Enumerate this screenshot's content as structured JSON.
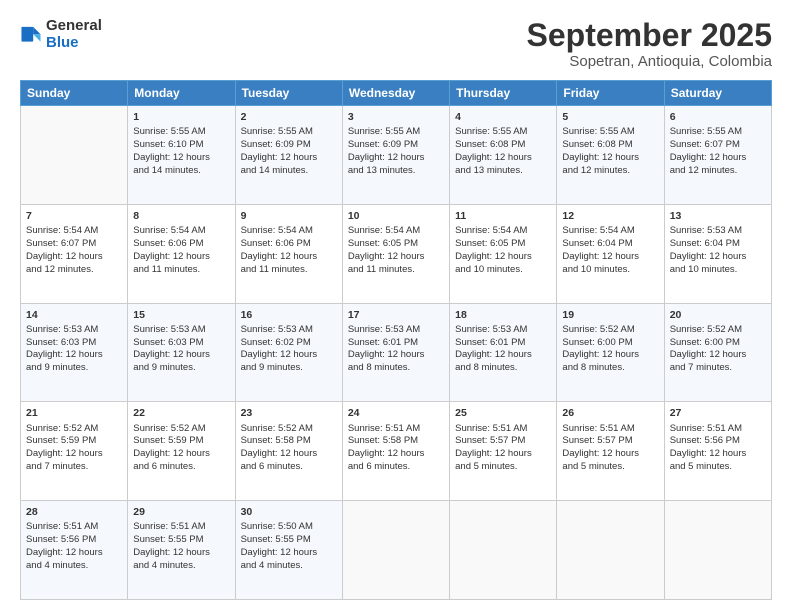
{
  "header": {
    "logo_line1": "General",
    "logo_line2": "Blue",
    "title": "September 2025",
    "subtitle": "Sopetran, Antioquia, Colombia"
  },
  "columns": [
    "Sunday",
    "Monday",
    "Tuesday",
    "Wednesday",
    "Thursday",
    "Friday",
    "Saturday"
  ],
  "weeks": [
    [
      {
        "day": "",
        "info": ""
      },
      {
        "day": "1",
        "info": "Sunrise: 5:55 AM\nSunset: 6:10 PM\nDaylight: 12 hours\nand 14 minutes."
      },
      {
        "day": "2",
        "info": "Sunrise: 5:55 AM\nSunset: 6:09 PM\nDaylight: 12 hours\nand 14 minutes."
      },
      {
        "day": "3",
        "info": "Sunrise: 5:55 AM\nSunset: 6:09 PM\nDaylight: 12 hours\nand 13 minutes."
      },
      {
        "day": "4",
        "info": "Sunrise: 5:55 AM\nSunset: 6:08 PM\nDaylight: 12 hours\nand 13 minutes."
      },
      {
        "day": "5",
        "info": "Sunrise: 5:55 AM\nSunset: 6:08 PM\nDaylight: 12 hours\nand 12 minutes."
      },
      {
        "day": "6",
        "info": "Sunrise: 5:55 AM\nSunset: 6:07 PM\nDaylight: 12 hours\nand 12 minutes."
      }
    ],
    [
      {
        "day": "7",
        "info": "Sunrise: 5:54 AM\nSunset: 6:07 PM\nDaylight: 12 hours\nand 12 minutes."
      },
      {
        "day": "8",
        "info": "Sunrise: 5:54 AM\nSunset: 6:06 PM\nDaylight: 12 hours\nand 11 minutes."
      },
      {
        "day": "9",
        "info": "Sunrise: 5:54 AM\nSunset: 6:06 PM\nDaylight: 12 hours\nand 11 minutes."
      },
      {
        "day": "10",
        "info": "Sunrise: 5:54 AM\nSunset: 6:05 PM\nDaylight: 12 hours\nand 11 minutes."
      },
      {
        "day": "11",
        "info": "Sunrise: 5:54 AM\nSunset: 6:05 PM\nDaylight: 12 hours\nand 10 minutes."
      },
      {
        "day": "12",
        "info": "Sunrise: 5:54 AM\nSunset: 6:04 PM\nDaylight: 12 hours\nand 10 minutes."
      },
      {
        "day": "13",
        "info": "Sunrise: 5:53 AM\nSunset: 6:04 PM\nDaylight: 12 hours\nand 10 minutes."
      }
    ],
    [
      {
        "day": "14",
        "info": "Sunrise: 5:53 AM\nSunset: 6:03 PM\nDaylight: 12 hours\nand 9 minutes."
      },
      {
        "day": "15",
        "info": "Sunrise: 5:53 AM\nSunset: 6:03 PM\nDaylight: 12 hours\nand 9 minutes."
      },
      {
        "day": "16",
        "info": "Sunrise: 5:53 AM\nSunset: 6:02 PM\nDaylight: 12 hours\nand 9 minutes."
      },
      {
        "day": "17",
        "info": "Sunrise: 5:53 AM\nSunset: 6:01 PM\nDaylight: 12 hours\nand 8 minutes."
      },
      {
        "day": "18",
        "info": "Sunrise: 5:53 AM\nSunset: 6:01 PM\nDaylight: 12 hours\nand 8 minutes."
      },
      {
        "day": "19",
        "info": "Sunrise: 5:52 AM\nSunset: 6:00 PM\nDaylight: 12 hours\nand 8 minutes."
      },
      {
        "day": "20",
        "info": "Sunrise: 5:52 AM\nSunset: 6:00 PM\nDaylight: 12 hours\nand 7 minutes."
      }
    ],
    [
      {
        "day": "21",
        "info": "Sunrise: 5:52 AM\nSunset: 5:59 PM\nDaylight: 12 hours\nand 7 minutes."
      },
      {
        "day": "22",
        "info": "Sunrise: 5:52 AM\nSunset: 5:59 PM\nDaylight: 12 hours\nand 6 minutes."
      },
      {
        "day": "23",
        "info": "Sunrise: 5:52 AM\nSunset: 5:58 PM\nDaylight: 12 hours\nand 6 minutes."
      },
      {
        "day": "24",
        "info": "Sunrise: 5:51 AM\nSunset: 5:58 PM\nDaylight: 12 hours\nand 6 minutes."
      },
      {
        "day": "25",
        "info": "Sunrise: 5:51 AM\nSunset: 5:57 PM\nDaylight: 12 hours\nand 5 minutes."
      },
      {
        "day": "26",
        "info": "Sunrise: 5:51 AM\nSunset: 5:57 PM\nDaylight: 12 hours\nand 5 minutes."
      },
      {
        "day": "27",
        "info": "Sunrise: 5:51 AM\nSunset: 5:56 PM\nDaylight: 12 hours\nand 5 minutes."
      }
    ],
    [
      {
        "day": "28",
        "info": "Sunrise: 5:51 AM\nSunset: 5:56 PM\nDaylight: 12 hours\nand 4 minutes."
      },
      {
        "day": "29",
        "info": "Sunrise: 5:51 AM\nSunset: 5:55 PM\nDaylight: 12 hours\nand 4 minutes."
      },
      {
        "day": "30",
        "info": "Sunrise: 5:50 AM\nSunset: 5:55 PM\nDaylight: 12 hours\nand 4 minutes."
      },
      {
        "day": "",
        "info": ""
      },
      {
        "day": "",
        "info": ""
      },
      {
        "day": "",
        "info": ""
      },
      {
        "day": "",
        "info": ""
      }
    ]
  ]
}
